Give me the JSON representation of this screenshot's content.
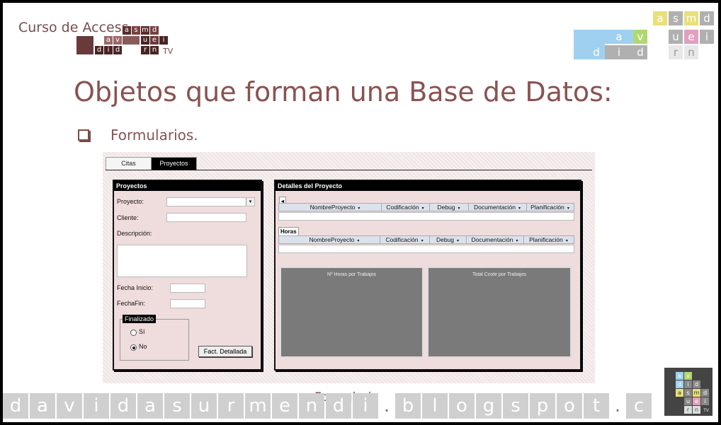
{
  "brand": {
    "title": "Curso de Access",
    "tv": "TV",
    "grid_letters": [
      "a",
      "s",
      "m",
      "d",
      "a",
      "v",
      "u",
      "e",
      "i",
      "d",
      "i",
      "d",
      "r",
      "n"
    ]
  },
  "logo_right": {
    "letters": [
      "a",
      "s",
      "m",
      "d",
      "a",
      "v",
      "u",
      "e",
      "i",
      "d",
      "i",
      "d",
      "r",
      "n"
    ]
  },
  "slide": {
    "title": "Objetos que forman una Base de Datos:",
    "bullet": "Formularios."
  },
  "form": {
    "tabs": [
      {
        "label": "Citas"
      },
      {
        "label": "Proyectos"
      }
    ],
    "left_panel": {
      "title": "Proyectos",
      "proyecto_label": "Proyecto:",
      "combo_arrow": "▾",
      "cliente_label": "Cliente:",
      "descripcion_label": "Descripción:",
      "fecha_inicio_label": "Fecha Inicio:",
      "fecha_fin_label": "FechaFin:",
      "group_title": "Finalizado",
      "radio_si": "Sí",
      "radio_no": "No",
      "button_label": "Fact. Detallada"
    },
    "right_panel": {
      "title": "Detalles del Proyecto",
      "grid_nav": "◂",
      "columns": [
        "NombreProyecto",
        "Codificación",
        "Debug",
        "Documentación",
        "Planificación"
      ],
      "dropdown_glyph": "▾",
      "horas_label": "Horas",
      "chart1_title": "Nº Horas por Trabajos",
      "chart2_title": "Total Coste por Trabajos"
    }
  },
  "caption": "Formulario",
  "url_chars": [
    "d",
    "a",
    "v",
    "i",
    "d",
    "a",
    "s",
    "u",
    "r",
    "m",
    "e",
    "n",
    "d",
    "i",
    ".",
    "b",
    "l",
    "o",
    "g",
    "s",
    "p",
    "o",
    "t",
    ".",
    "c"
  ],
  "bottom_logo": {
    "letters": [
      "a",
      "v",
      "d",
      "i",
      "d",
      "a",
      "s",
      "m",
      "d",
      "u",
      "e",
      "i",
      "r",
      "n"
    ],
    "tv": "TV"
  }
}
